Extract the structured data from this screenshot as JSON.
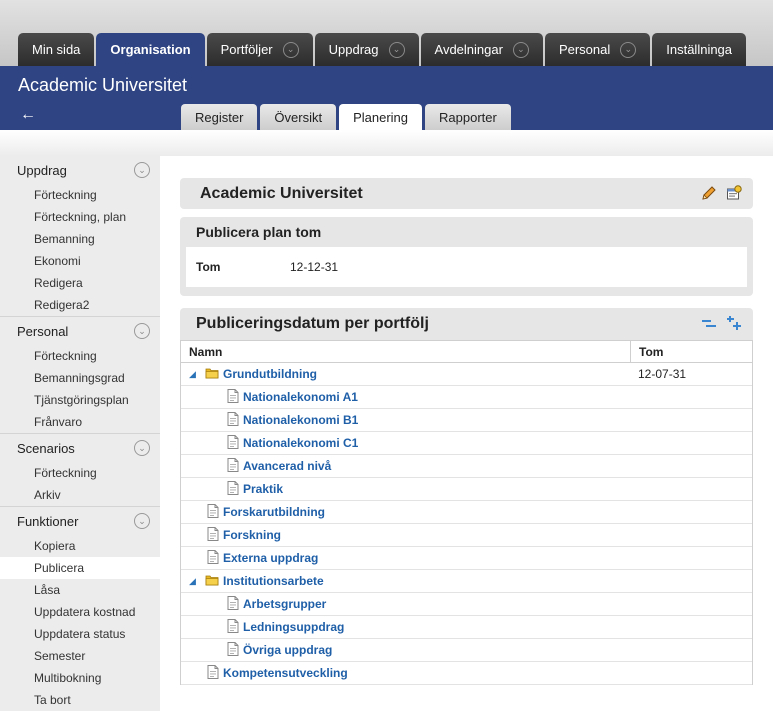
{
  "main_tabs": [
    {
      "label": "Min sida",
      "active": false,
      "has_dropdown": false
    },
    {
      "label": "Organisation",
      "active": true,
      "has_dropdown": false
    },
    {
      "label": "Portföljer",
      "active": false,
      "has_dropdown": true
    },
    {
      "label": "Uppdrag",
      "active": false,
      "has_dropdown": true
    },
    {
      "label": "Avdelningar",
      "active": false,
      "has_dropdown": true
    },
    {
      "label": "Personal",
      "active": false,
      "has_dropdown": true
    },
    {
      "label": "Inställninga",
      "active": false,
      "has_dropdown": false
    }
  ],
  "header": {
    "org_title": "Academic Universitet",
    "back_icon": "arrow-left-icon"
  },
  "sub_tabs": [
    {
      "label": "Register",
      "active": false
    },
    {
      "label": "Översikt",
      "active": false
    },
    {
      "label": "Planering",
      "active": true
    },
    {
      "label": "Rapporter",
      "active": false
    }
  ],
  "sidebar": {
    "sections": [
      {
        "title": "Uppdrag",
        "items": [
          "Förteckning",
          "Förteckning, plan",
          "Bemanning",
          "Ekonomi",
          "Redigera",
          "Redigera2"
        ]
      },
      {
        "title": "Personal",
        "items": [
          "Förteckning",
          "Bemanningsgrad",
          "Tjänstgöringsplan",
          "Frånvaro"
        ]
      },
      {
        "title": "Scenarios",
        "items": [
          "Förteckning",
          "Arkiv"
        ]
      },
      {
        "title": "Funktioner",
        "items": [
          "Kopiera",
          "Publicera",
          "Låsa",
          "Uppdatera kostnad",
          "Uppdatera status",
          "Semester",
          "Multibokning",
          "Ta bort"
        ]
      }
    ],
    "active_item": "Publicera"
  },
  "panel_org": {
    "title": "Academic Universitet",
    "icons": [
      "pencil-icon",
      "properties-icon"
    ]
  },
  "panel_publish": {
    "title": "Publicera plan tom",
    "key": "Tom",
    "value": "12-12-31"
  },
  "panel_tree": {
    "title": "Publiceringsdatum per portfölj",
    "icons": [
      "collapse-all-icon",
      "expand-all-icon"
    ],
    "columns": {
      "name": "Namn",
      "tom": "Tom"
    },
    "rows": [
      {
        "label": "Grundutbildning",
        "level": 0,
        "type": "folder",
        "tom": "12-07-31"
      },
      {
        "label": "Nationalekonomi A1",
        "level": 1,
        "type": "doc",
        "tom": ""
      },
      {
        "label": "Nationalekonomi B1",
        "level": 1,
        "type": "doc",
        "tom": ""
      },
      {
        "label": "Nationalekonomi C1",
        "level": 1,
        "type": "doc",
        "tom": ""
      },
      {
        "label": "Avancerad nivå",
        "level": 1,
        "type": "doc",
        "tom": ""
      },
      {
        "label": "Praktik",
        "level": 1,
        "type": "doc",
        "tom": ""
      },
      {
        "label": "Forskarutbildning",
        "level": 0,
        "type": "doc",
        "tom": ""
      },
      {
        "label": "Forskning",
        "level": 0,
        "type": "doc",
        "tom": ""
      },
      {
        "label": "Externa uppdrag",
        "level": 0,
        "type": "doc",
        "tom": ""
      },
      {
        "label": "Institutionsarbete",
        "level": 0,
        "type": "folder",
        "tom": ""
      },
      {
        "label": "Arbetsgrupper",
        "level": 1,
        "type": "doc",
        "tom": ""
      },
      {
        "label": "Ledningsuppdrag",
        "level": 1,
        "type": "doc",
        "tom": ""
      },
      {
        "label": "Övriga uppdrag",
        "level": 1,
        "type": "doc",
        "tom": ""
      },
      {
        "label": "Kompetensutveckling",
        "level": 0,
        "type": "doc",
        "tom": ""
      }
    ]
  },
  "colors": {
    "brand_blue": "#2f4583",
    "link_blue": "#1f5fa8",
    "tab_dark": "#333333",
    "folder_yellow": "#e8b923"
  }
}
